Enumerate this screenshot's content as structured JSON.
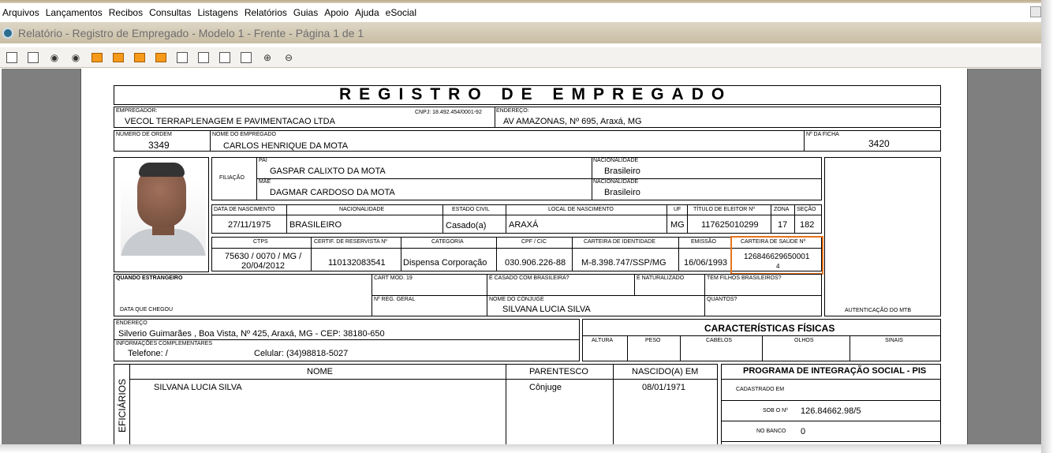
{
  "menu": [
    "Arquivos",
    "Lançamentos",
    "Recibos",
    "Consultas",
    "Listagens",
    "Relatórios",
    "Guias",
    "Apoio",
    "Ajuda",
    "eSocial"
  ],
  "window_title": "Relatório - Registro de Empregado - Modelo 1 - Frente - Página 1 de 1",
  "toolbar_icons": [
    "printer-icon",
    "export-icon",
    "binoculars-icon",
    "find-next-icon",
    "first-page-icon",
    "previous-page-icon",
    "next-page-icon",
    "last-page-icon",
    "single-page-icon",
    "page-width-icon",
    "two-pages-icon",
    "multi-page-icon",
    "zoom-in-icon",
    "zoom-out-icon"
  ],
  "report": {
    "title": "REGISTRO   DE   EMPREGADO",
    "empregador_label": "EMPREGADOR:",
    "empregador": "VECOL TERRAPLENAGEM E PAVIMENTACAO LTDA",
    "cnpj": "CNPJ: 18.492.454/0001-92",
    "endereco_label": "ENDEREÇO:",
    "endereco_empresa": "AV AMAZONAS, Nº 695, Araxá, MG",
    "numero_ordem_label": "NÚMERO DE ORDEM",
    "numero_ordem": "3349",
    "nome_label": "NOME DO EMPREGADO",
    "nome": "CARLOS HENRIQUE DA MOTA",
    "ficha_label": "Nº DA FICHA",
    "ficha": "3420",
    "filiacao_label": "FILIAÇÃO",
    "pai_label": "PAI",
    "pai": "GASPAR CALIXTO DA MOTA",
    "mae_label": "MÃE",
    "mae": "DAGMAR CARDOSO DA MOTA",
    "nacionalidade_label": "NACIONALIDADE",
    "nac_pai": "Brasileiro",
    "nac_mae": "Brasileiro",
    "nasc_headers": [
      "DATA DE NASCIMENTO",
      "NACIONALIDADE",
      "ESTADO CIVIL",
      "LOCAL DE NASCIMENTO",
      "UF",
      "TÍTULO DE ELEITOR Nº",
      "ZONA",
      "SEÇÃO"
    ],
    "nasc_values": [
      "27/11/1975",
      "BRASILEIRO",
      "Casado(a)",
      "ARAXÁ",
      "MG",
      "117625010299",
      "17",
      "182"
    ],
    "docs_headers": [
      "CTPS",
      "CERTIF. DE RESERVISTA Nº",
      "CATEGORIA",
      "CPF / CIC",
      "CARTEIRA DE IDENTIDADE",
      "EMISSÃO",
      "CARTEIRA DE SAÚDE Nº"
    ],
    "ctps_line1": "75630 / 0070 / MG /",
    "ctps_line2": "20/04/2012",
    "reservista": "110132083541",
    "categoria": "Dispensa Corporação",
    "cpf": "030.906.226-88",
    "identidade": "M-8.398.747/SSP/MG",
    "emissao": "16/06/1993",
    "saude": "126846629650001",
    "saude2": "4",
    "estrangeiro_label": "QUANDO ESTRANGEIRO",
    "cart_mod_label": "CART MOD. 19",
    "casado_label": "É CASADO COM BRASILEIRA?",
    "naturalizado_label": "É NATURALIZADO",
    "filhos_label": "TEM FILHOS BRASILEIROS?",
    "data_chegou_label": "DATA QUE CHEGOU",
    "reg_geral_label": "Nº REG. GERAL",
    "conjuge_label": "NOME DO CÔNJUGE",
    "conjuge": "SILVANA LUCIA SILVA",
    "quantos_label": "QUANTOS?",
    "autenticacao_label": "AUTENTICAÇÃO DO MTB",
    "endereco2_label": "ENDEREÇO",
    "endereco_empregado": "Silverio Guimarães , Boa Vista, Nº 425, Araxá, MG - CEP: 38180-650",
    "info_label": "INFORMAÇÕES COMPLEMENTARES",
    "telefone": "Telefone:      /",
    "celular": "Celular: (34)98818-5027",
    "caracteristicas_title": "CARACTERÍSTICAS FÍSICAS",
    "caracteristicas_headers": [
      "ALTURA",
      "PESO",
      "CABELOS",
      "OLHOS",
      "SINAIS"
    ],
    "benef_vertical": "EFICIÁRIOS",
    "benef_headers": [
      "NOME",
      "PARENTESCO",
      "NASCIDO(A) EM"
    ],
    "benef_nome": "SILVANA LUCIA SILVA",
    "benef_parentesco": "Cônjuge",
    "benef_nascido": "08/01/1971",
    "pis_title": "PROGRAMA DE INTEGRAÇÃO SOCIAL - PIS",
    "pis_cadastrado_label": "CADASTRADO EM",
    "pis_sob_label": "SOB O Nº",
    "pis_numero": "126.84662.98/5",
    "pis_banco_label": "NO BANCO",
    "pis_banco": "0"
  }
}
